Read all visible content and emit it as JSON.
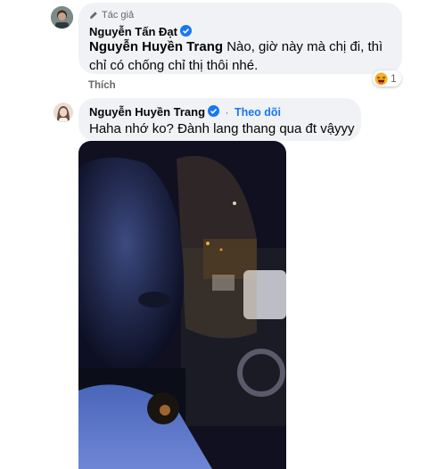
{
  "comment1": {
    "author_badge": "Tác giả",
    "author_name": "Nguyễn Tấn Đạt",
    "mention": "Nguyễn Huyền Trang",
    "text_line1_rest": " Nào, giờ này mà chị đi, thì",
    "text_line2": "chỉ có chống chỉ thị thôi nhé.",
    "like_label": "Thích",
    "reaction_icon": "haha-emoji-icon",
    "reaction_count": "1"
  },
  "comment2": {
    "author_name": "Nguyễn Huyền Trang",
    "separator": "·",
    "follow_label": "Theo dõi",
    "text": "Haha nhớ ko? Đành lang thang qua đt vậyyy"
  },
  "colors": {
    "bubble": "#f0f2f5",
    "verified": "#1877f2",
    "secondary_text": "#65676b"
  }
}
